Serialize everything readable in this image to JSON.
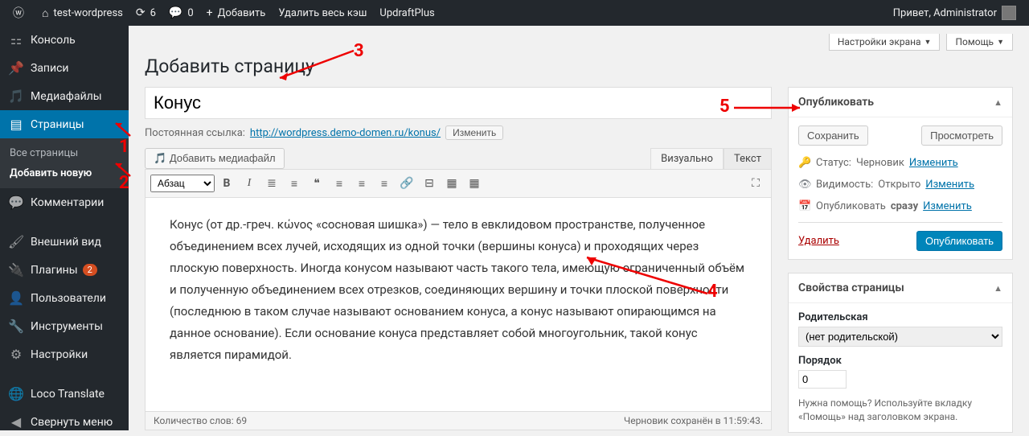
{
  "adminbar": {
    "site_name": "test-wordpress",
    "updates": "6",
    "comments": "0",
    "add_new": "Добавить",
    "clear_cache": "Удалить весь кэш",
    "updraft": "UpdraftPlus",
    "howdy": "Привет, Administrator"
  },
  "sidebar": {
    "dashboard": "Консоль",
    "posts": "Записи",
    "media": "Медиафайлы",
    "pages": "Страницы",
    "pages_all": "Все страницы",
    "pages_add": "Добавить новую",
    "comments": "Комментарии",
    "appearance": "Внешний вид",
    "plugins": "Плагины",
    "plugins_count": "2",
    "users": "Пользователи",
    "tools": "Инструменты",
    "settings": "Настройки",
    "loco": "Loco Translate",
    "collapse": "Свернуть меню"
  },
  "screen_meta": {
    "screen_options": "Настройки экрана",
    "help": "Помощь"
  },
  "page": {
    "heading": "Добавить страницу",
    "title_value": "Конус",
    "permalink_label": "Постоянная ссылка:",
    "permalink_url": "http://wordpress.demo-domen.ru/konus/",
    "permalink_edit": "Изменить",
    "add_media": "Добавить медиафайл",
    "tab_visual": "Визуально",
    "tab_text": "Текст",
    "format_select": "Абзац",
    "content": "Конус (от др.-греч. κώνος «сосновая шишка») — тело в евклидовом пространстве, полученное объединением всех лучей, исходящих из одной точки (вершины конуса) и проходящих через плоскую поверхность. Иногда конусом называют часть такого тела, имеющую ограниченный объём и полученную объединением всех отрезков, соединяющих вершину и точки плоской поверхности (последнюю в таком случае называют основанием конуса, а конус называют опирающимся на данное основание). Если основание конуса представляет собой многоугольник, такой конус является пирамидой.",
    "word_count_label": "Количество слов: ",
    "word_count": "69",
    "draft_saved": "Черновик сохранён в 11:59:43."
  },
  "publish": {
    "title": "Опубликовать",
    "save_draft": "Сохранить",
    "preview": "Просмотреть",
    "status_label": "Статус:",
    "status_value": "Черновик",
    "visibility_label": "Видимость:",
    "visibility_value": "Открыто",
    "schedule_label": "Опубликовать",
    "schedule_value": "сразу",
    "edit": "Изменить",
    "delete": "Удалить",
    "publish_btn": "Опубликовать"
  },
  "attributes": {
    "title": "Свойства страницы",
    "parent_label": "Родительская",
    "parent_value": "(нет родительской)",
    "order_label": "Порядок",
    "order_value": "0",
    "help_text": "Нужна помощь? Используйте вкладку «Помощь» над заголовком экрана."
  },
  "annotations": {
    "n1": "1",
    "n2": "2",
    "n3": "3",
    "n4": "4",
    "n5": "5"
  }
}
